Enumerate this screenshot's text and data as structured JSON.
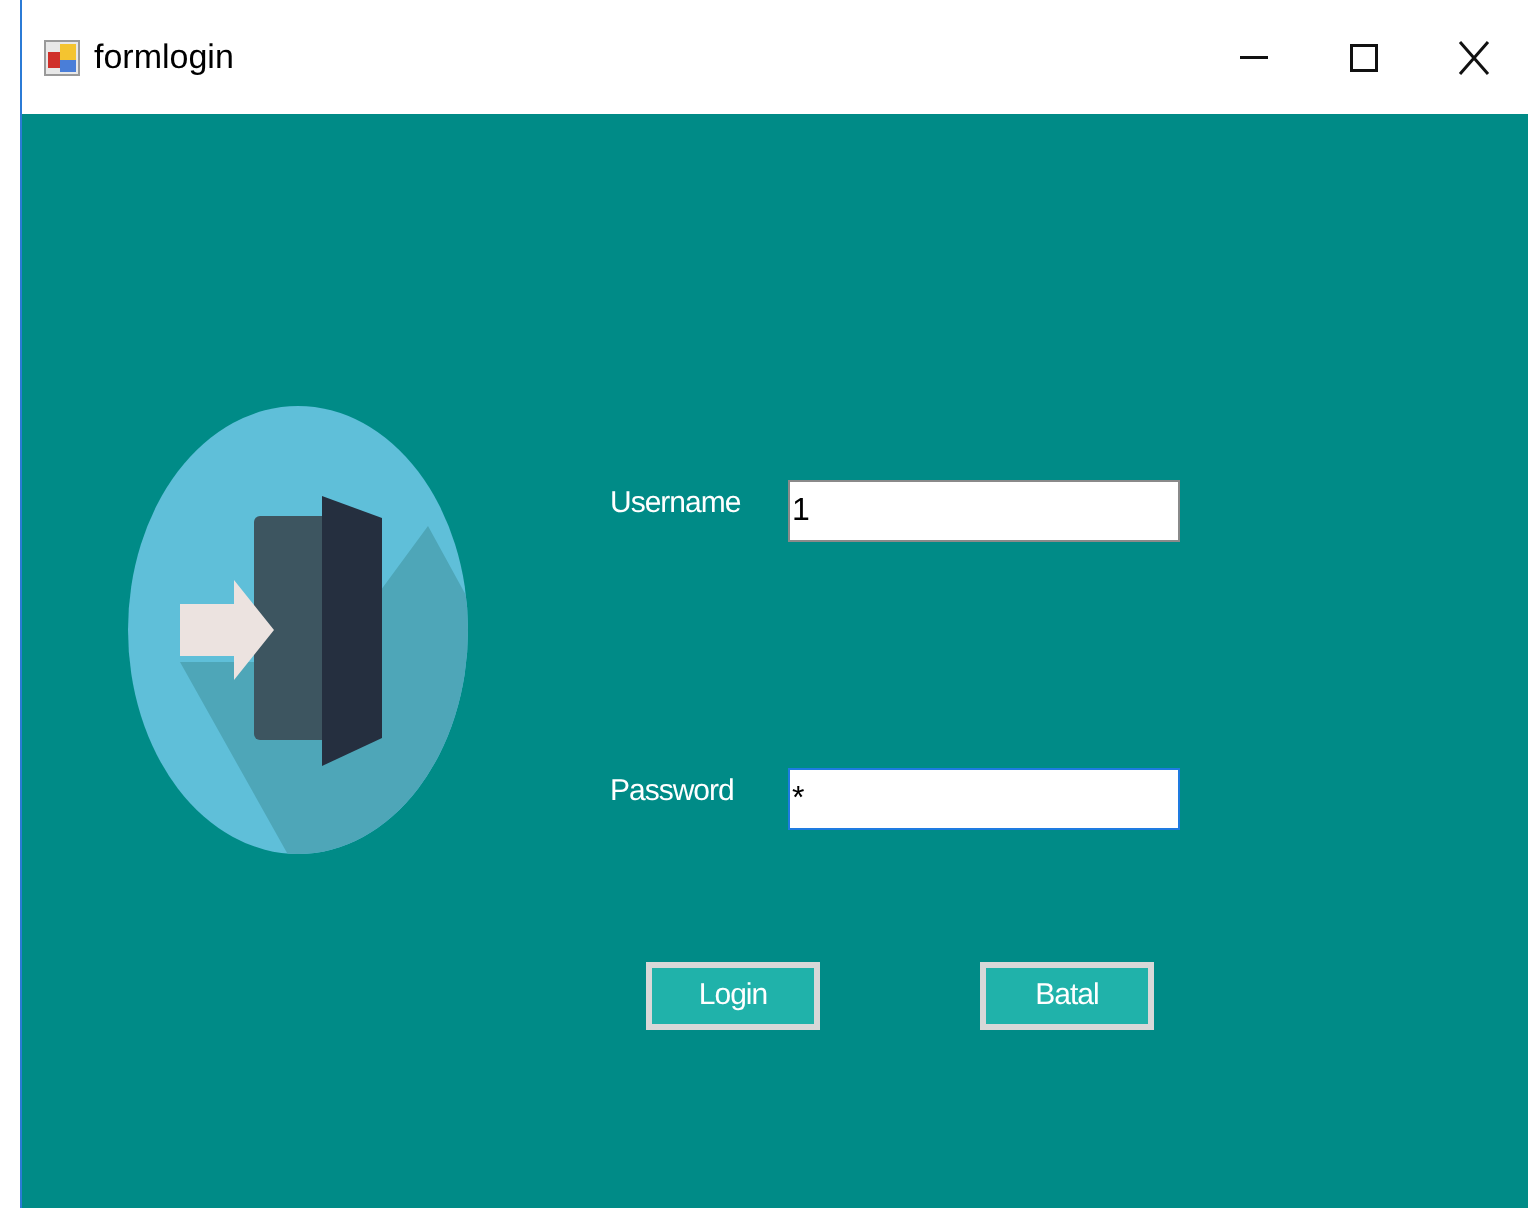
{
  "window": {
    "title": "formlogin"
  },
  "fields": [
    {
      "label": "Username",
      "value": "1",
      "focused": false
    },
    {
      "label": "Password",
      "value": "*",
      "focused": true
    }
  ],
  "buttons": [
    "Login",
    "Batal"
  ]
}
